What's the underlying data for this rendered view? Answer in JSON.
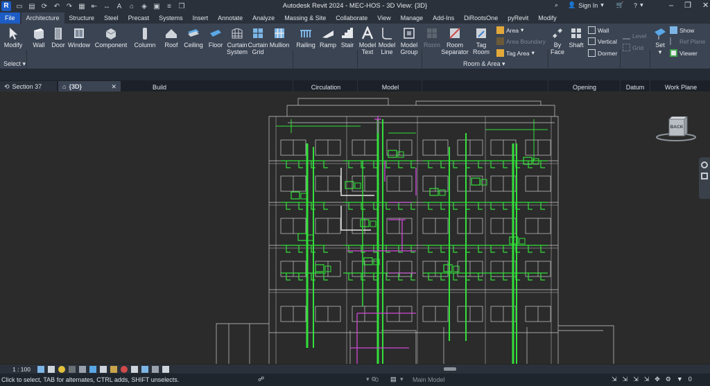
{
  "app": {
    "title": "Autodesk Revit 2024 - MEC-HOS - 3D View: {3D}",
    "logo_letter": "R",
    "sign_in": "Sign In"
  },
  "quick_access": [
    "open-icon",
    "save-icon",
    "sync-icon",
    "undo-icon",
    "redo-icon",
    "print-icon",
    "measure-icon",
    "dimension-icon",
    "text-icon",
    "home-icon",
    "3d-view-icon",
    "section-icon",
    "thin-lines-icon",
    "switch-windows-icon"
  ],
  "ribbon_tabs": [
    "File",
    "Architecture",
    "Structure",
    "Steel",
    "Precast",
    "Systems",
    "Insert",
    "Annotate",
    "Analyze",
    "Massing & Site",
    "Collaborate",
    "View",
    "Manage",
    "Add-Ins",
    "DiRootsOne",
    "pyRevit",
    "Modify"
  ],
  "active_tab": "Architecture",
  "ribbon": {
    "select": {
      "modify": "Modify",
      "panel": "Select"
    },
    "build": {
      "panel": "Build",
      "wall": "Wall",
      "door": "Door",
      "window": "Window",
      "component": "Component",
      "column": "Column",
      "roof": "Roof",
      "ceiling": "Ceiling",
      "floor": "Floor",
      "curtain_system_1": "Curtain",
      "curtain_system_2": "System",
      "curtain_grid_1": "Curtain",
      "curtain_grid_2": "Grid",
      "mullion": "Mullion"
    },
    "circulation": {
      "panel": "Circulation",
      "railing": "Railing",
      "ramp": "Ramp",
      "stair": "Stair"
    },
    "model": {
      "panel": "Model",
      "model_text_1": "Model",
      "model_text_2": "Text",
      "model_line_1": "Model",
      "model_line_2": "Line",
      "model_group_1": "Model",
      "model_group_2": "Group"
    },
    "room_area": {
      "panel": "Room & Area",
      "room": "Room",
      "room_separator_1": "Room",
      "room_separator_2": "Separator",
      "tag_room_1": "Tag",
      "tag_room_2": "Room",
      "area": "Area",
      "area_boundary": "Area  Boundary",
      "tag_area": "Tag  Area"
    },
    "opening": {
      "panel": "Opening",
      "by_face_1": "By",
      "by_face_2": "Face",
      "shaft": "Shaft",
      "wall": "Wall",
      "vertical": "Vertical",
      "dormer": "Dormer"
    },
    "datum": {
      "panel": "Datum",
      "level": "Level",
      "grid": "Grid"
    },
    "work_plane": {
      "panel": "Work Plane",
      "set": "Set",
      "show": "Show",
      "ref_plane": "Ref  Plane",
      "viewer": "Viewer"
    }
  },
  "doc_tabs": [
    {
      "label": "Section 37",
      "active": false
    },
    {
      "label": "{3D}",
      "active": true
    }
  ],
  "viewcube": {
    "face": "BACK"
  },
  "view_control": {
    "scale": "1 : 100"
  },
  "status": {
    "message": "Click to select, TAB for alternates, CTRL adds, SHIFT unselects.",
    "workset_count": "0",
    "model": "Main Model",
    "filter_count": "0"
  },
  "colors": {
    "titlebar": "#2b313b",
    "ribbon": "#3b4453",
    "file_tab": "#1d5cc4",
    "viewport": "#2b2b2b",
    "pipe_green": "#33e03a",
    "pipe_magenta": "#d04ad8",
    "building_lines": "#d8d8d8"
  }
}
